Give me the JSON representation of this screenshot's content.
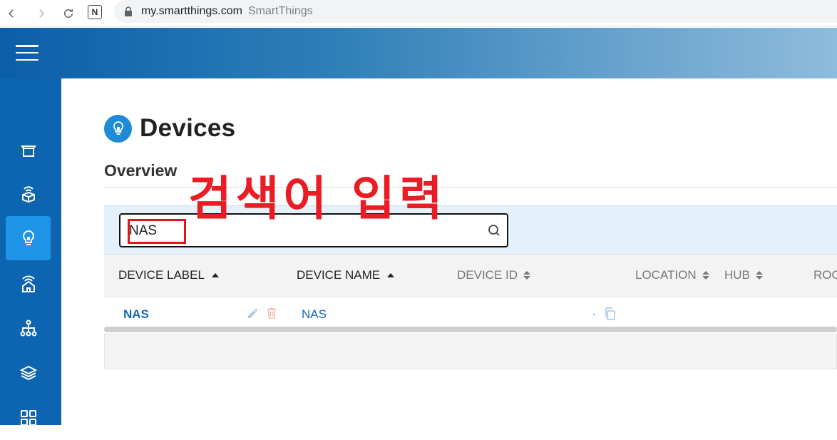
{
  "browser": {
    "url_host": "my.smartthings.com",
    "page_title": "SmartThings",
    "extension_label": "N"
  },
  "header": {
    "menu_icon": "hamburger-icon"
  },
  "sidebar": {
    "items": [
      {
        "icon": "box-icon",
        "active": false
      },
      {
        "icon": "hub-device-icon",
        "active": false
      },
      {
        "icon": "lightbulb-icon",
        "active": true
      },
      {
        "icon": "wifi-home-icon",
        "active": false
      },
      {
        "icon": "network-icon",
        "active": false
      },
      {
        "icon": "layers-icon",
        "active": false
      },
      {
        "icon": "apps-icon",
        "active": false
      }
    ]
  },
  "page": {
    "title": "Devices",
    "section": "Overview",
    "icon": "lightbulb-icon"
  },
  "annotation": {
    "text": "검색어 입력",
    "color": "#ea1c24"
  },
  "search": {
    "value": "NAS",
    "placeholder": ""
  },
  "table": {
    "columns": [
      {
        "label": "DEVICE LABEL",
        "sort": "asc-active"
      },
      {
        "label": "DEVICE NAME",
        "sort": "asc-active"
      },
      {
        "label": "DEVICE ID",
        "sort": "both"
      },
      {
        "label": "LOCATION",
        "sort": "both"
      },
      {
        "label": "HUB",
        "sort": "both"
      },
      {
        "label": "ROO",
        "sort": "none"
      }
    ],
    "rows": [
      {
        "label": "NAS",
        "name": "NAS",
        "id": "."
      }
    ]
  },
  "colors": {
    "accent": "#1f8ad8",
    "sidebar": "#0d64b0",
    "link": "#1568b7"
  }
}
